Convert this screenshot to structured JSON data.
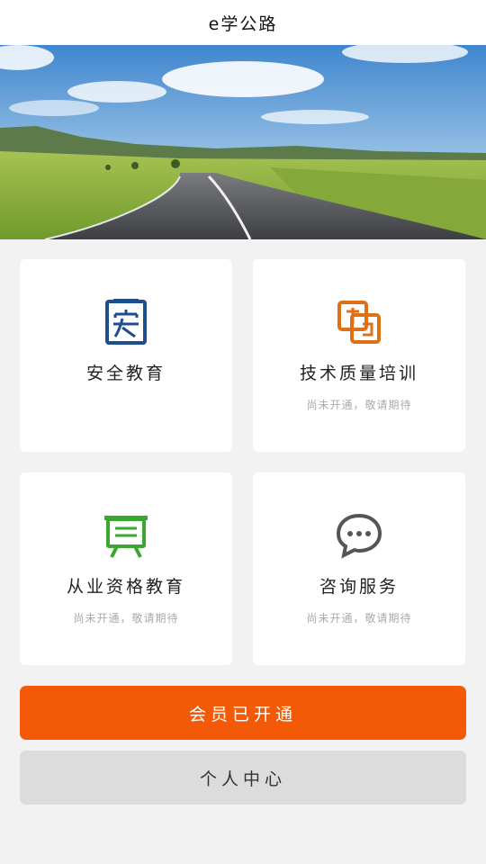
{
  "app": {
    "title": "e学公路"
  },
  "hero": {
    "image_name": "highway-landscape-banner"
  },
  "cards": [
    {
      "label": "安全教育",
      "subtitle": "",
      "icon": "safety-education-icon",
      "icon_color": "#1f4e8c"
    },
    {
      "label": "技术质量培训",
      "subtitle": "尚未开通，敬请期待",
      "icon": "technical-quality-training-icon",
      "icon_color": "#e07014"
    },
    {
      "label": "从业资格教育",
      "subtitle": "尚未开通，敬请期待",
      "icon": "qualification-education-icon",
      "icon_color": "#3aa830"
    },
    {
      "label": "咨询服务",
      "subtitle": "尚未开通，敬请期待",
      "icon": "consulting-chat-icon",
      "icon_color": "#555555"
    }
  ],
  "buttons": {
    "member_label": "会员已开通",
    "personal_label": "个人中心"
  },
  "colors": {
    "accent": "#f25a08",
    "background": "#f2f2f2",
    "secondary_button": "#dcdcdc"
  }
}
